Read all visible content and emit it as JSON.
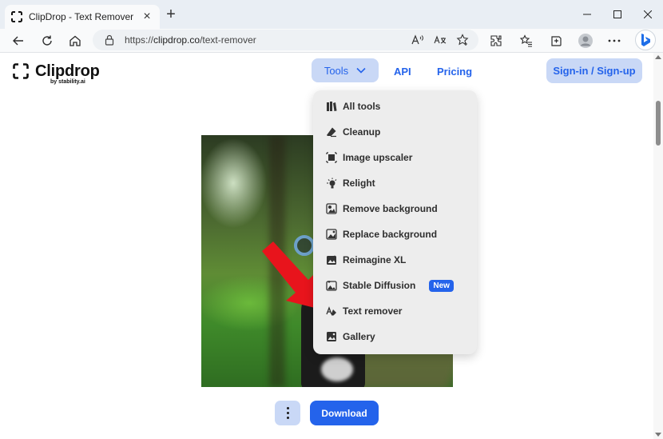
{
  "browser": {
    "tab_title": "ClipDrop - Text Remover",
    "url_prefix": "https://",
    "url_host": "clipdrop.co",
    "url_path": "/text-remover",
    "icons": [
      "refresh-icon",
      "home-icon",
      "read-aloud-icon",
      "translate-icon",
      "favorite-icon",
      "extensions-icon",
      "favorites-bar-icon",
      "collections-icon",
      "profile-icon",
      "more-icon",
      "bing-icon"
    ]
  },
  "header": {
    "brand": "Clipdrop",
    "brand_sub": "by stability.ai",
    "tools_label": "Tools",
    "api_label": "API",
    "pricing_label": "Pricing",
    "signin_label": "Sign-in / Sign-up"
  },
  "menu": {
    "items": [
      {
        "label": "All tools",
        "icon": "all-tools-icon"
      },
      {
        "label": "Cleanup",
        "icon": "eraser-icon"
      },
      {
        "label": "Image upscaler",
        "icon": "upscale-icon"
      },
      {
        "label": "Relight",
        "icon": "relight-icon"
      },
      {
        "label": "Remove background",
        "icon": "remove-background-icon"
      },
      {
        "label": "Replace background",
        "icon": "replace-background-icon"
      },
      {
        "label": "Reimagine XL",
        "icon": "reimagine-icon"
      },
      {
        "label": "Stable Diffusion",
        "icon": "stable-diffusion-icon",
        "badge": "New"
      },
      {
        "label": "Text remover",
        "icon": "text-remover-icon"
      },
      {
        "label": "Gallery",
        "icon": "gallery-icon"
      }
    ]
  },
  "actions": {
    "download_label": "Download"
  },
  "colors": {
    "accent": "#2463eb",
    "accent_light": "#c9d8f6",
    "menu_bg": "#ededed",
    "arrow": "#e8141c"
  }
}
